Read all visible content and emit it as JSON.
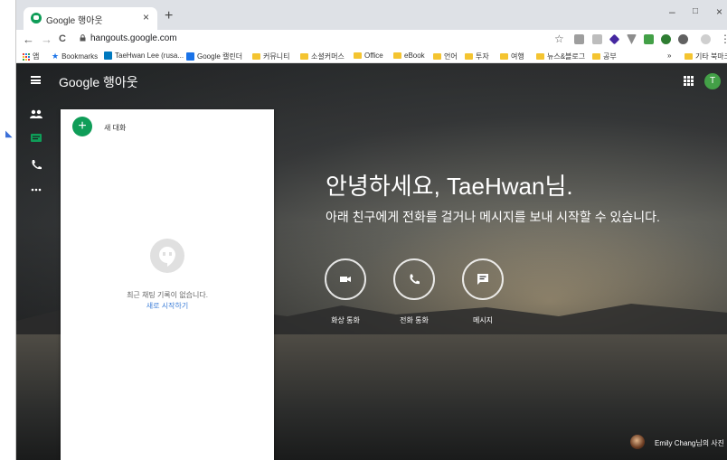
{
  "browser": {
    "tab_title": "Google 행아웃",
    "tab_close": "×",
    "new_tab": "+",
    "window_minimize": "–",
    "window_maximize": "□",
    "window_close": "×",
    "nav_back": "←",
    "nav_forward": "→",
    "nav_reload": "C",
    "url": "hangouts.google.com",
    "star": "☆",
    "menu": "⋮"
  },
  "bookmarks": [
    {
      "label": "앱"
    },
    {
      "label": "Bookmarks"
    },
    {
      "label": "TaeHwan Lee (rusa..."
    },
    {
      "label": "Google 캘린더"
    },
    {
      "label": "커뮤니티"
    },
    {
      "label": "소셜커머스"
    },
    {
      "label": "Office"
    },
    {
      "label": "eBook"
    },
    {
      "label": "언어"
    },
    {
      "label": "투자"
    },
    {
      "label": "여행"
    },
    {
      "label": "뉴스&블로그"
    },
    {
      "label": "공부"
    },
    {
      "label": "기타 북마크"
    }
  ],
  "bookmarks_more": "»",
  "app": {
    "brand": "Google 행아웃",
    "avatar_initial": "T"
  },
  "panel": {
    "new_chat_icon": "+",
    "new_chat_label": "새 대화",
    "empty_text": "최근 채팅 기록이 없습니다.",
    "empty_link": "새로 시작하기"
  },
  "hero": {
    "greeting": "안녕하세요, TaeHwan님.",
    "subtext": "아래 친구에게 전화를 걸거나 메시지를 보내 시작할 수 있습니다."
  },
  "actions": [
    {
      "label": "화상 통화",
      "icon": "videocam-icon"
    },
    {
      "label": "전화 통화",
      "icon": "phone-icon"
    },
    {
      "label": "메시지",
      "icon": "message-icon"
    }
  ],
  "credit": {
    "text": "Emily Chang님의 사진"
  },
  "colors": {
    "hangouts_green": "#0f9d58",
    "link_blue": "#3f7fd8",
    "tab_strip": "#dee1e6"
  }
}
